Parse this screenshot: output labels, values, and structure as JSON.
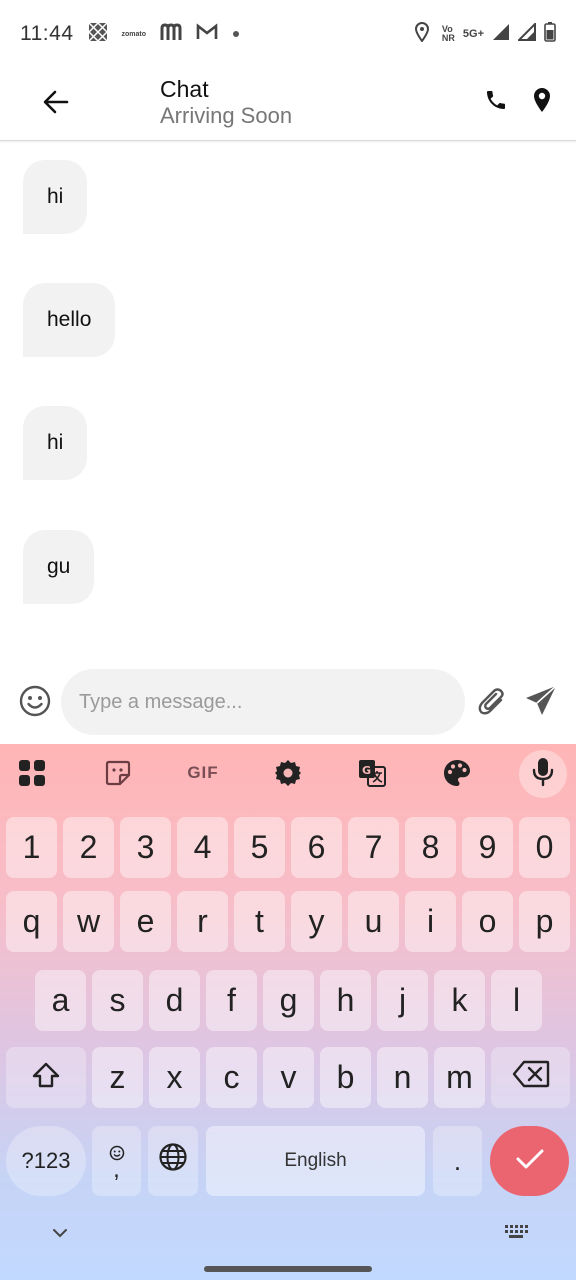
{
  "status_bar": {
    "time": "11:44",
    "left_icons": [
      "grid-pattern-icon",
      "zomato-icon",
      "m-logo-icon",
      "gmail-icon",
      "dot-icon"
    ],
    "zomato_text": "zomato",
    "right_icons": [
      "location-icon",
      "volte-icon",
      "5g-icon",
      "signal-icon",
      "signal-icon",
      "battery-icon"
    ],
    "volte_top": "Vo",
    "volte_bottom": "NR",
    "network": "5G+"
  },
  "app_bar": {
    "title": "Chat",
    "subtitle": "Arriving Soon",
    "icons": [
      "back-arrow-icon",
      "phone-icon",
      "location-pin-icon"
    ]
  },
  "messages": [
    {
      "text": "hi"
    },
    {
      "text": "hello"
    },
    {
      "text": "hi"
    },
    {
      "text": "gu"
    }
  ],
  "composer": {
    "placeholder": "Type a message...",
    "icons": [
      "emoji-icon",
      "paperclip-icon",
      "send-icon"
    ]
  },
  "keyboard": {
    "toolbar_icons": [
      "apps-grid-icon",
      "sticker-icon",
      "gif-icon",
      "settings-gear-icon",
      "translate-icon",
      "palette-icon",
      "microphone-icon"
    ],
    "gif_label": "GIF",
    "number_row": [
      "1",
      "2",
      "3",
      "4",
      "5",
      "6",
      "7",
      "8",
      "9",
      "0"
    ],
    "row1": [
      "q",
      "w",
      "e",
      "r",
      "t",
      "y",
      "u",
      "i",
      "o",
      "p"
    ],
    "row2": [
      "a",
      "s",
      "d",
      "f",
      "g",
      "h",
      "j",
      "k",
      "l"
    ],
    "row3": [
      "z",
      "x",
      "c",
      "v",
      "b",
      "n",
      "m"
    ],
    "symbols_label": "?123",
    "emoji_comma": ",",
    "space_label": "English",
    "period_label": ".",
    "accent_color": "#ea6570",
    "nav_icons": [
      "chevron-down-icon",
      "keyboard-icon"
    ]
  }
}
